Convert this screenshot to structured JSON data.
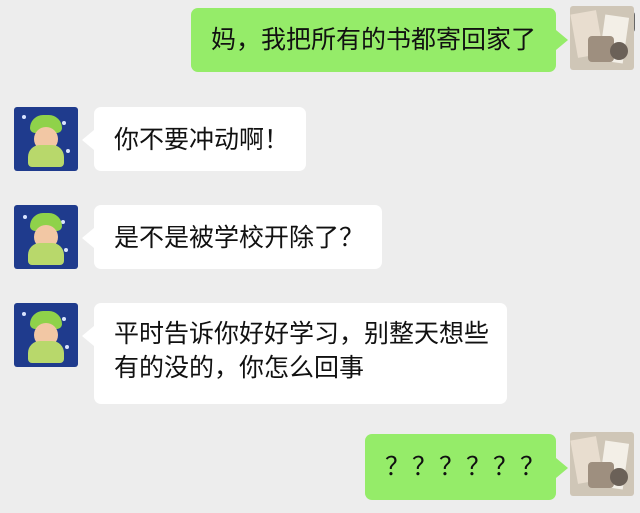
{
  "messages": [
    {
      "sender": "me",
      "text": "妈，我把所有的书都寄回家了"
    },
    {
      "sender": "mom",
      "text": "你不要冲动啊！"
    },
    {
      "sender": "mom",
      "text": "是不是被学校开除了？"
    },
    {
      "sender": "mom",
      "text_line1": "平时告诉你好好学习，别整天想些",
      "text_line2": "有的没的，你怎么回事"
    },
    {
      "sender": "me",
      "text": "？？？？？？"
    }
  ],
  "icons": {
    "corner": "image-search-icon",
    "mom_avatar": "cartoon-avatar-icon",
    "me_avatar": "photo-avatar-icon"
  },
  "colors": {
    "background": "#ededed",
    "incoming_bubble": "#ffffff",
    "outgoing_bubble": "#95ec69",
    "text": "#111111"
  }
}
